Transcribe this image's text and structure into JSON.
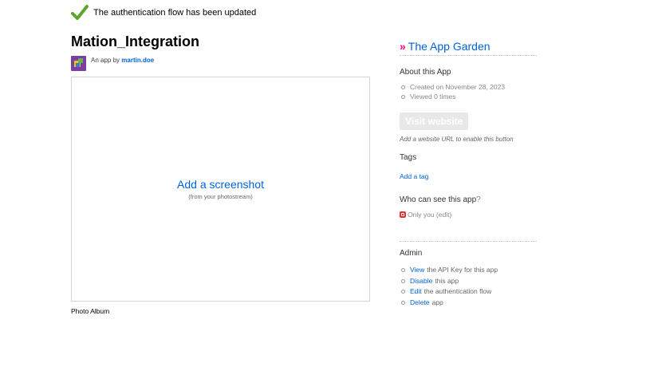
{
  "notice": {
    "text": "The authentication flow has been updated"
  },
  "app": {
    "title": "Mation_Integration",
    "byline_prefix": "An app by",
    "author": "martin.doe"
  },
  "screenshot": {
    "add_label": "Add a screenshot",
    "sub_label": "(from your photostream)"
  },
  "photo_album": "Photo Album",
  "sidebar": {
    "header_arrow": "»",
    "header_title": "The App Garden",
    "about_title": "About this App",
    "about_items": [
      "Created on November 28, 2023",
      "Viewed 0 times"
    ],
    "visit_button": "Visit website",
    "visit_note": "Add a website URL to enable this button",
    "tags_title": "Tags",
    "add_tag": "Add a tag",
    "who_title": "Who can see this app",
    "who_q": "?",
    "privacy_label": "Only you",
    "privacy_edit": "(edit)",
    "admin_title": "Admin",
    "admin_items": [
      {
        "link": "View",
        "text": "the API Key for this app"
      },
      {
        "link": "Disable",
        "text": "this app"
      },
      {
        "link": "Edit",
        "text": "the authentication flow"
      },
      {
        "link": "Delete",
        "text": "app"
      }
    ]
  },
  "colors": {
    "link": "#0063dc",
    "accent_pink": "#ff0084",
    "check_green": "#5aa62a"
  }
}
